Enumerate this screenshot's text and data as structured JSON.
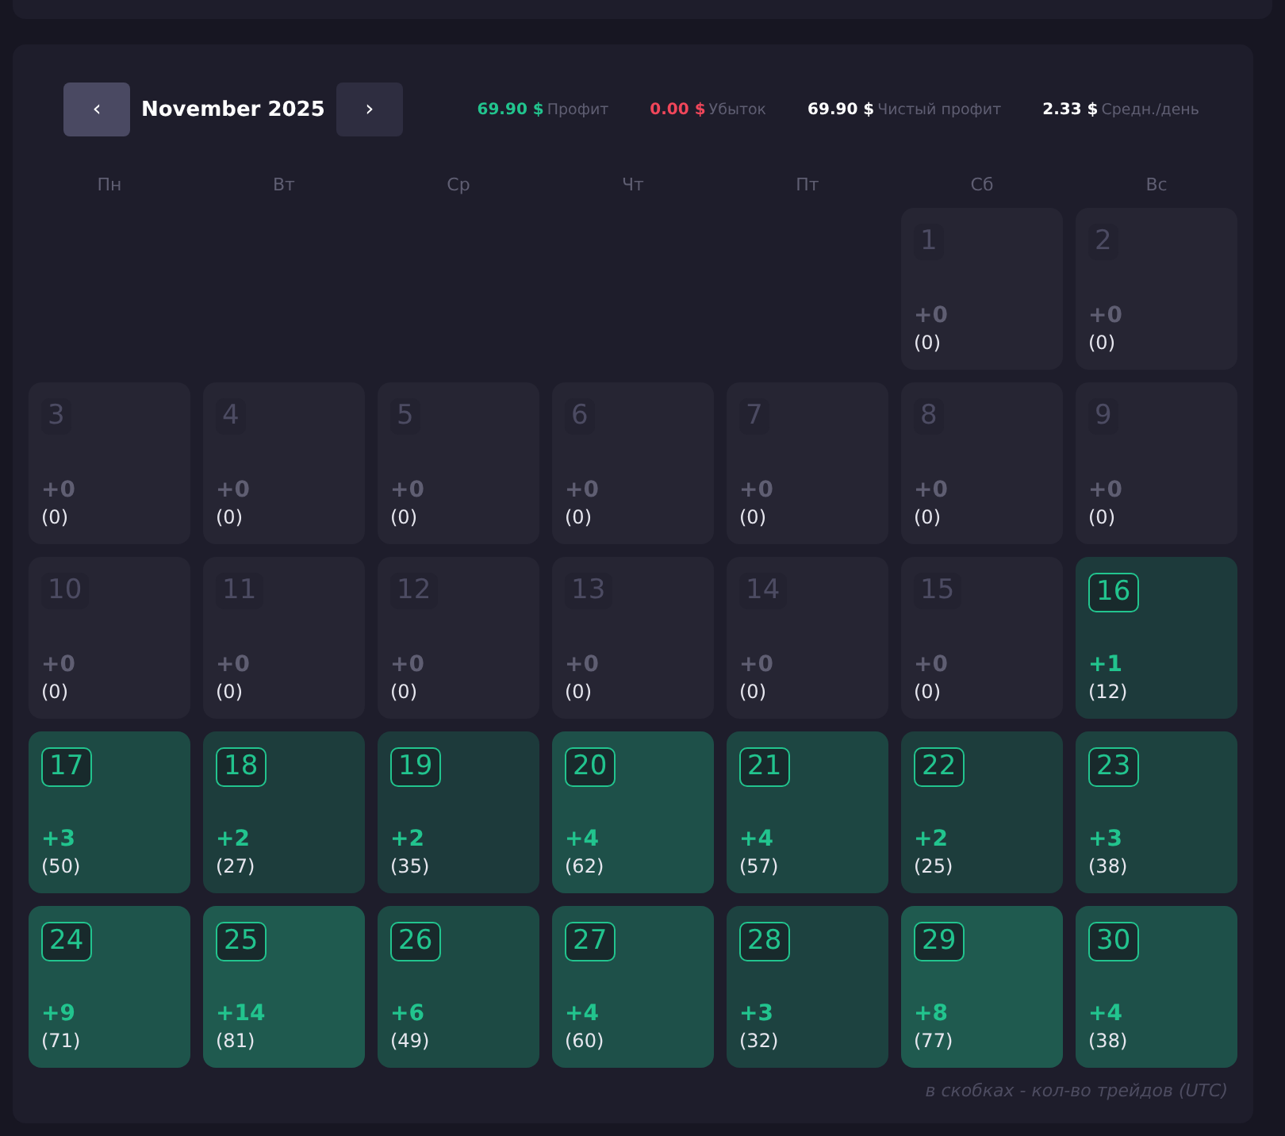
{
  "header": {
    "prev": "‹",
    "month": "November 2025",
    "next": "›"
  },
  "stats": [
    {
      "value": "69.90 $",
      "label": "Профит",
      "color": "#22c48e"
    },
    {
      "value": "0.00 $",
      "label": "Убыток",
      "color": "#f0465a"
    },
    {
      "value": "69.90 $",
      "label": "Чистый профит",
      "color": "#ffffff"
    },
    {
      "value": "2.33 $",
      "label": "Средн./день",
      "color": "#ffffff"
    }
  ],
  "weekdays": [
    "Пн",
    "Вт",
    "Ср",
    "Чт",
    "Пт",
    "Сб",
    "Вс"
  ],
  "days": [
    {
      "kind": "blank"
    },
    {
      "kind": "blank"
    },
    {
      "kind": "blank"
    },
    {
      "kind": "blank"
    },
    {
      "kind": "blank"
    },
    {
      "kind": "idle",
      "day": "1",
      "change": "+0",
      "trades": "(0)",
      "color": "#262533"
    },
    {
      "kind": "idle",
      "day": "2",
      "change": "+0",
      "trades": "(0)",
      "color": "#262533"
    },
    {
      "kind": "idle",
      "day": "3",
      "change": "+0",
      "trades": "(0)",
      "color": "#262533"
    },
    {
      "kind": "idle",
      "day": "4",
      "change": "+0",
      "trades": "(0)",
      "color": "#262533"
    },
    {
      "kind": "idle",
      "day": "5",
      "change": "+0",
      "trades": "(0)",
      "color": "#262533"
    },
    {
      "kind": "idle",
      "day": "6",
      "change": "+0",
      "trades": "(0)",
      "color": "#262533"
    },
    {
      "kind": "idle",
      "day": "7",
      "change": "+0",
      "trades": "(0)",
      "color": "#262533"
    },
    {
      "kind": "idle",
      "day": "8",
      "change": "+0",
      "trades": "(0)",
      "color": "#262533"
    },
    {
      "kind": "idle",
      "day": "9",
      "change": "+0",
      "trades": "(0)",
      "color": "#262533"
    },
    {
      "kind": "idle",
      "day": "10",
      "change": "+0",
      "trades": "(0)",
      "color": "#262533"
    },
    {
      "kind": "idle",
      "day": "11",
      "change": "+0",
      "trades": "(0)",
      "color": "#262533"
    },
    {
      "kind": "idle",
      "day": "12",
      "change": "+0",
      "trades": "(0)",
      "color": "#262533"
    },
    {
      "kind": "idle",
      "day": "13",
      "change": "+0",
      "trades": "(0)",
      "color": "#262533"
    },
    {
      "kind": "idle",
      "day": "14",
      "change": "+0",
      "trades": "(0)",
      "color": "#262533"
    },
    {
      "kind": "idle",
      "day": "15",
      "change": "+0",
      "trades": "(0)",
      "color": "#262533"
    },
    {
      "kind": "active",
      "day": "16",
      "change": "+1",
      "trades": "(12)",
      "color": "#1d3a3b"
    },
    {
      "kind": "active",
      "day": "17",
      "change": "+3",
      "trades": "(50)",
      "color": "#1d4a44"
    },
    {
      "kind": "active",
      "day": "18",
      "change": "+2",
      "trades": "(27)",
      "color": "#1d3d3c"
    },
    {
      "kind": "active",
      "day": "19",
      "change": "+2",
      "trades": "(35)",
      "color": "#1d3a3b"
    },
    {
      "kind": "active",
      "day": "20",
      "change": "+4",
      "trades": "(62)",
      "color": "#1e5049"
    },
    {
      "kind": "active",
      "day": "21",
      "change": "+4",
      "trades": "(57)",
      "color": "#1d4642"
    },
    {
      "kind": "active",
      "day": "22",
      "change": "+2",
      "trades": "(25)",
      "color": "#1d3d3c"
    },
    {
      "kind": "active",
      "day": "23",
      "change": "+3",
      "trades": "(38)",
      "color": "#1d423f"
    },
    {
      "kind": "active",
      "day": "24",
      "change": "+9",
      "trades": "(71)",
      "color": "#1e544b"
    },
    {
      "kind": "active",
      "day": "25",
      "change": "+14",
      "trades": "(81)",
      "color": "#1f5a4f"
    },
    {
      "kind": "active",
      "day": "26",
      "change": "+6",
      "trades": "(49)",
      "color": "#1d4a44"
    },
    {
      "kind": "active",
      "day": "27",
      "change": "+4",
      "trades": "(60)",
      "color": "#1e5049"
    },
    {
      "kind": "active",
      "day": "28",
      "change": "+3",
      "trades": "(32)",
      "color": "#1d4240"
    },
    {
      "kind": "active",
      "day": "29",
      "change": "+8",
      "trades": "(77)",
      "color": "#1f5a4f"
    },
    {
      "kind": "active",
      "day": "30",
      "change": "+4",
      "trades": "(38)",
      "color": "#1e5049"
    }
  ],
  "footnote": "в скобках - кол-во трейдов (UTC)"
}
